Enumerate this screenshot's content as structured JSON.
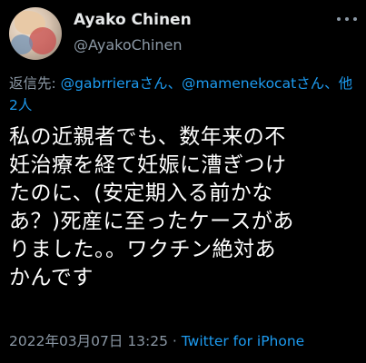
{
  "author": {
    "display_name": "Ayako Chinen",
    "handle": "@AyakoChinen",
    "avatar_icon": "profile-photo"
  },
  "reply": {
    "prefix": "返信先: ",
    "mention1": "@gabrriera",
    "sep1": "さん、",
    "mention2": "@mamenekocat",
    "sep2": "さん、",
    "others": "他2人"
  },
  "tweet": {
    "text": "私の近親者でも、数年来の不\n妊治療を経て妊娠に漕ぎつけ\nたのに、(安定期入る前かな\nあ？)死産に至ったケースがあ\nりました。。ワクチン絶対あ\nかんです"
  },
  "meta": {
    "timestamp": "2022年03月07日 13:25",
    "dot": " · ",
    "source": "Twitter for iPhone"
  },
  "colors": {
    "background": "#000000",
    "text": "#e7e9ea",
    "secondary": "#8b98a5",
    "link": "#1d9bf0"
  }
}
